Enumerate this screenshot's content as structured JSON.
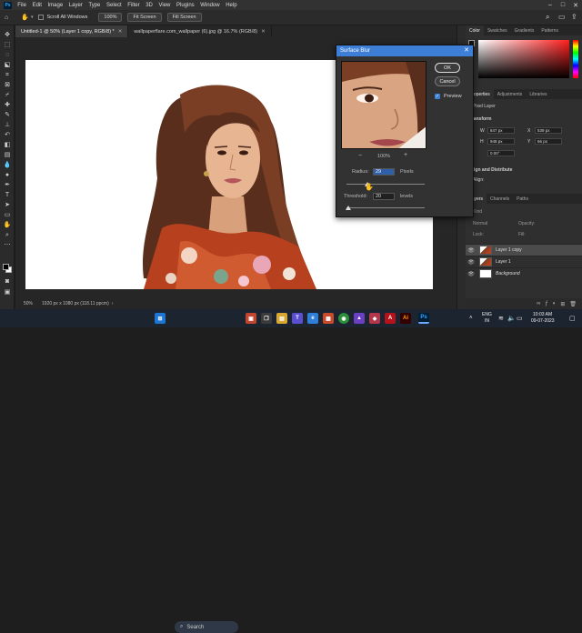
{
  "menubar": {
    "logo": "Ps",
    "items": [
      "File",
      "Edit",
      "Image",
      "Layer",
      "Type",
      "Select",
      "Filter",
      "3D",
      "View",
      "Plugins",
      "Window",
      "Help"
    ]
  },
  "options": {
    "scroll_all_label": "Scroll All Windows",
    "zoom_value": "100%",
    "fit_screen": "Fit Screen",
    "fill_screen": "Fill Screen"
  },
  "tabs": [
    {
      "label": "Untitled-1 @ 50% (Layer 1 copy, RGB/8) *"
    },
    {
      "label": "wallpaperflare.com_wallpaper (6).jpg @ 16.7% (RGB/8)"
    }
  ],
  "status": {
    "zoom": "50%",
    "doc_info": "1920 px x 1080 px (118.11 ppcm)"
  },
  "panels": {
    "top_tabs": [
      "Color",
      "Swatches",
      "Gradients",
      "Patterns"
    ],
    "props_tabs": [
      "Properties",
      "Adjustments",
      "Libraries"
    ],
    "pixel_layer": "Pixel Layer",
    "transform": "Transform",
    "w_label": "W",
    "w_value": "847 px",
    "h_label": "H",
    "h_value": "948 px",
    "x_label": "X",
    "x_value": "539 px",
    "y_label": "Y",
    "y_value": "66 px",
    "angle_value": "0.00°",
    "align": "Align and Distribute",
    "align_sub": "Align:",
    "layers_tabs": [
      "Layers",
      "Channels",
      "Paths"
    ],
    "kind": "Kind",
    "blend_mode": "Normal",
    "opacity_label": "Opacity:",
    "lock_label": "Lock:",
    "fill_label": "Fill:",
    "layers": [
      {
        "name": "Layer 1 copy",
        "selected": true
      },
      {
        "name": "Layer 1",
        "selected": false
      },
      {
        "name": "Background",
        "selected": false
      }
    ]
  },
  "dialog": {
    "title": "Surface Blur",
    "ok": "OK",
    "cancel": "Cancel",
    "preview_label": "Preview",
    "preview_checked": true,
    "zoom": "100%",
    "zoom_out": "−",
    "zoom_in": "+",
    "radius_label": "Radius:",
    "radius_value": "29",
    "radius_unit": "Pixels",
    "threshold_label": "Threshold:",
    "threshold_value": "20",
    "threshold_unit": "levels"
  },
  "taskbar": {
    "search": "Search",
    "lang1": "ENG",
    "lang2": "IN",
    "time": "10:03 AM",
    "date": "09-07-2023"
  },
  "colors": {
    "accent": "#3d7fd6",
    "ps_icon_bg": "#001e36",
    "ps_icon_fg": "#31a8ff"
  }
}
